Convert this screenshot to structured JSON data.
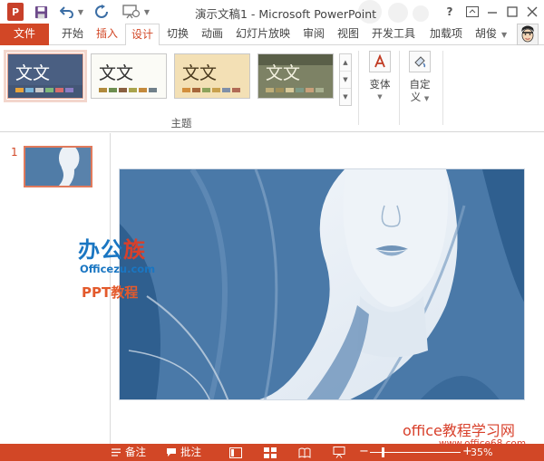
{
  "window": {
    "title": "演示文稿1 - Microsoft PowerPoint",
    "app_icon": "powerpoint-logo",
    "app_icon_letter": "P",
    "quick_access": [
      "save-icon",
      "undo-icon",
      "redo-icon",
      "slideshow-from-start-icon"
    ],
    "controls": {
      "help": "?",
      "restore": "ribbon-display-icon",
      "minimize": "minimize-icon",
      "maximize": "maximize-icon",
      "close": "close-icon"
    }
  },
  "ribbon": {
    "tabs": [
      {
        "label": "文件"
      },
      {
        "label": "开始"
      },
      {
        "label": "插入"
      },
      {
        "label": "设计"
      },
      {
        "label": "切换"
      },
      {
        "label": "动画"
      },
      {
        "label": "幻灯片放映"
      },
      {
        "label": "审阅"
      },
      {
        "label": "视图"
      },
      {
        "label": "开发工具"
      },
      {
        "label": "加载项"
      }
    ],
    "active_tab": "设计",
    "user_name": "胡俊",
    "themes": [
      {
        "sample": "文文",
        "bg": "#4a5f82",
        "fg": "#ffffff",
        "swatches": [
          "#e8a33a",
          "#79b4d8",
          "#c9c9c9",
          "#7fb87a",
          "#d86c6c",
          "#8b7cc4"
        ]
      },
      {
        "sample": "文文",
        "bg": "#fbfbf6",
        "fg": "#333333",
        "swatches": [
          "#b08a3c",
          "#6d8e4f",
          "#8a6040",
          "#a9a44c",
          "#c48a3c",
          "#70808a"
        ]
      },
      {
        "sample": "文文",
        "bg": "#f3e0b5",
        "fg": "#4a3a1e",
        "swatches": [
          "#d28e3c",
          "#a6663a",
          "#8ca25b",
          "#c8a04e",
          "#7f8fa8",
          "#b06a55"
        ]
      },
      {
        "sample": "文文",
        "bg": "#7d8265",
        "fg": "#f4f1e0",
        "swatches": [
          "#bfae79",
          "#9f8f5a",
          "#d8c99a",
          "#7d9a87",
          "#c9a07a",
          "#a8b090"
        ]
      }
    ],
    "theme_group_label": "主题",
    "variants_label": "变体",
    "customize_label_1": "自定",
    "customize_label_2": "义"
  },
  "thumbnails": {
    "number": "1"
  },
  "watermark": {
    "brand_main": "办公",
    "brand_accent": "族",
    "brand_url": "Officezu.com",
    "brand_sub": "PPT教程",
    "site_name": "office教程学习网",
    "site_url": "www.office68.com"
  },
  "statusbar": {
    "notes_label": "备注",
    "comments_label": "批注",
    "zoom_percent": "35%",
    "zoom_fraction": 0.35
  },
  "colors": {
    "accent": "#d24726",
    "image_tint": "#3f6f9e"
  }
}
